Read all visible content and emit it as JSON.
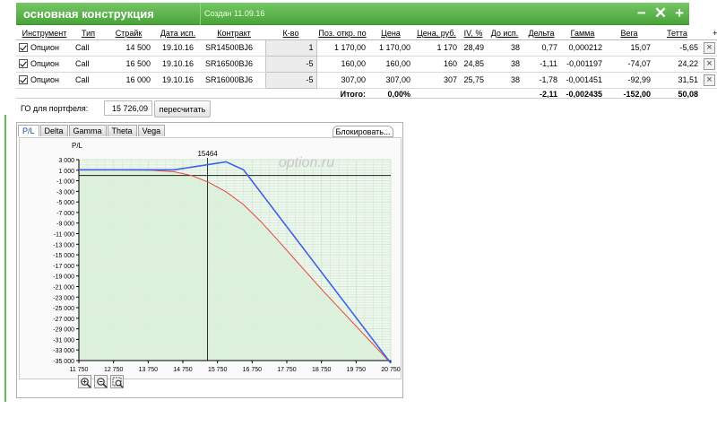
{
  "window": {
    "title": "основная конструкция",
    "created": "Создан 11.09.16",
    "buttons": [
      "−",
      "✕",
      "+"
    ]
  },
  "table": {
    "headers": [
      "Инструмент",
      "Тип",
      "Страйк",
      "Дата исп.",
      "Контракт",
      "К-во",
      "Поз. откр. по",
      "Цена",
      "Цена, руб.",
      "IV, %",
      "До исп.",
      "Дельта",
      "Гамма",
      "Вега",
      "Тетта",
      "+/-"
    ],
    "rows": [
      {
        "instrument": "Опцион",
        "type": "Call",
        "strike": "14 500",
        "date": "19.10.16",
        "contract": "SR14500BJ6",
        "qty": "1",
        "open": "1 170,00",
        "price": "1 170,00",
        "price_rub": "1 170",
        "iv": "28,49",
        "days": "38",
        "delta": "0,77",
        "gamma": "0,000212",
        "vega": "15,07",
        "theta": "-5,65"
      },
      {
        "instrument": "Опцион",
        "type": "Call",
        "strike": "16 500",
        "date": "19.10.16",
        "contract": "SR16500BJ6",
        "qty": "-5",
        "open": "160,00",
        "price": "160,00",
        "price_rub": "160",
        "iv": "24,85",
        "days": "38",
        "delta": "-1,11",
        "gamma": "-0,001197",
        "vega": "-74,07",
        "theta": "24,22"
      },
      {
        "instrument": "Опцион",
        "type": "Call",
        "strike": "16 000",
        "date": "19.10.16",
        "contract": "SR16000BJ6",
        "qty": "-5",
        "open": "307,00",
        "price": "307,00",
        "price_rub": "307",
        "iv": "25,75",
        "days": "38",
        "delta": "-1,78",
        "gamma": "-0,001451",
        "vega": "-92,99",
        "theta": "31,51"
      }
    ],
    "totals": {
      "label": "Итого:",
      "price": "0,00%",
      "delta": "-2,11",
      "gamma": "-0,002435",
      "vega": "-152,00",
      "theta": "50,08"
    }
  },
  "portfolio": {
    "go_label": "ГО для портфеля:",
    "go_value": "15 726,09",
    "recalc_button": "пересчитать"
  },
  "chart_panel": {
    "tabs": [
      "P/L",
      "Delta",
      "Gamma",
      "Theta",
      "Vega"
    ],
    "active_tab": "P/L",
    "lock_button": "Блокировать...",
    "watermark": "option.ru",
    "zoom_buttons": [
      "zoom-in-icon",
      "zoom-out-icon",
      "zoom-box-icon"
    ]
  },
  "chart_data": {
    "type": "line",
    "ylabel": "P/L",
    "marker_label": "15464",
    "marker_x": 15464,
    "xlim": [
      11750,
      20750
    ],
    "ylim": [
      -35000,
      3000
    ],
    "grid": true,
    "x_ticks": [
      "11 750",
      "12 750",
      "13 750",
      "14 750",
      "15 750",
      "16 750",
      "17 750",
      "18 750",
      "19 750",
      "20 750"
    ],
    "y_ticks": [
      "3 000",
      "1 000",
      "-1 000",
      "-3 000",
      "-5 000",
      "-7 000",
      "-9 000",
      "-11 000",
      "-13 000",
      "-15 000",
      "-17 000",
      "-19 000",
      "-21 000",
      "-23 000",
      "-25 000",
      "-27 000",
      "-29 000",
      "-31 000",
      "-33 000",
      "-35 000"
    ],
    "series": [
      {
        "color": "#4060e8",
        "x": [
          11750,
          14500,
          16000,
          16500,
          20750
        ],
        "y": [
          1085,
          1085,
          2585,
          1085,
          -35490
        ]
      },
      {
        "color": "#e8453c",
        "x": [
          11750,
          13800,
          14500,
          15000,
          15500,
          16000,
          16500,
          17000,
          17500,
          18000,
          18750,
          20750
        ],
        "y": [
          1085,
          1000,
          700,
          0,
          -1300,
          -3100,
          -5500,
          -8700,
          -12300,
          -16000,
          -21500,
          -35490
        ]
      }
    ],
    "colors": {
      "zero_line": "#000000",
      "marker_line": "#000000",
      "area": "#daf0da",
      "grid": "#cfe6cf"
    }
  }
}
